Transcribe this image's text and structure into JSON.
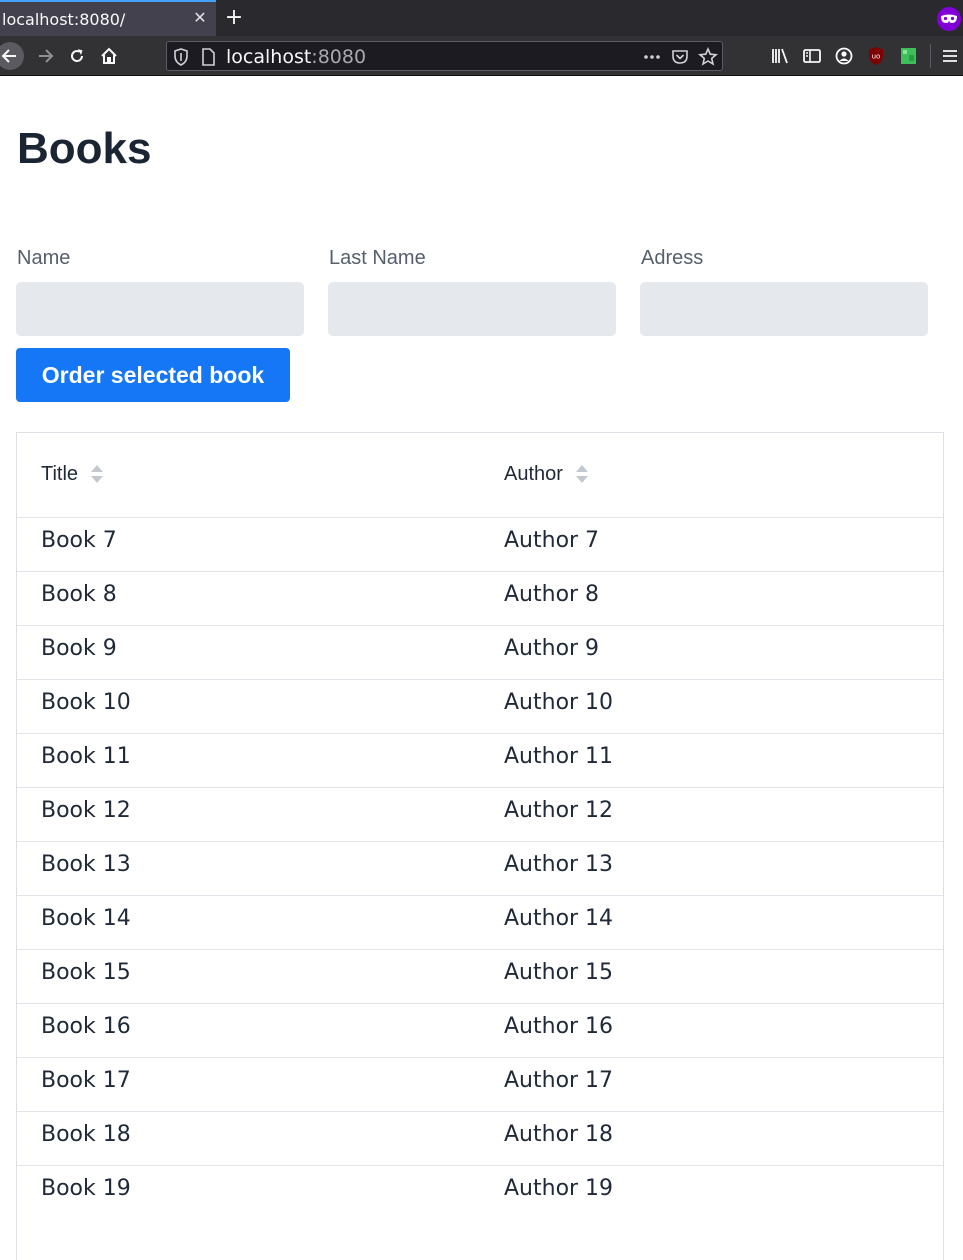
{
  "browser": {
    "tab_title": "localhost:8080/",
    "url_host": "localhost",
    "url_port": ":8080"
  },
  "page": {
    "title": "Books"
  },
  "form": {
    "name_label": "Name",
    "last_name_label": "Last Name",
    "address_label": "Adress",
    "name_value": "",
    "last_name_value": "",
    "address_value": "",
    "order_button_label": "Order selected book"
  },
  "grid": {
    "columns": [
      "Title",
      "Author"
    ],
    "rows": [
      {
        "title": "Book 7",
        "author": "Author 7"
      },
      {
        "title": "Book 8",
        "author": "Author 8"
      },
      {
        "title": "Book 9",
        "author": "Author 9"
      },
      {
        "title": "Book 10",
        "author": "Author 10"
      },
      {
        "title": "Book 11",
        "author": "Author 11"
      },
      {
        "title": "Book 12",
        "author": "Author 12"
      },
      {
        "title": "Book 13",
        "author": "Author 13"
      },
      {
        "title": "Book 14",
        "author": "Author 14"
      },
      {
        "title": "Book 15",
        "author": "Author 15"
      },
      {
        "title": "Book 16",
        "author": "Author 16"
      },
      {
        "title": "Book 17",
        "author": "Author 17"
      },
      {
        "title": "Book 18",
        "author": "Author 18"
      },
      {
        "title": "Book 19",
        "author": "Author 19"
      }
    ]
  },
  "colors": {
    "primary_button": "#1677f6",
    "input_background": "#e5e8ec",
    "chrome_dark": "#2a2a2e",
    "private_badge": "#8000d7"
  },
  "icons": {
    "tab_close": "close-icon",
    "new_tab": "plus-icon",
    "back": "back-arrow-icon",
    "forward": "forward-arrow-icon",
    "reload": "reload-icon",
    "home": "home-icon",
    "tracking": "shield-icon",
    "page": "page-icon",
    "more": "more-icon",
    "pocket": "pocket-icon",
    "bookmark": "star-icon",
    "library": "library-icon",
    "sidebar": "sidebar-icon",
    "account": "account-icon",
    "ublock": "ublock-icon",
    "extension": "extension-icon",
    "menu": "hamburger-icon",
    "private": "private-browsing-icon",
    "sort": "sort-icon"
  }
}
